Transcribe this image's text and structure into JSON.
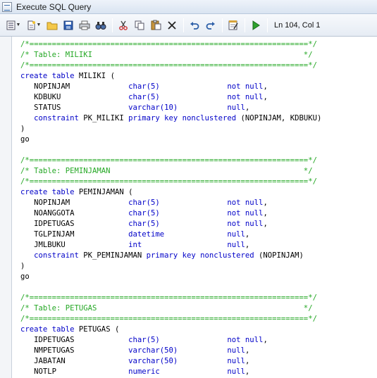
{
  "window": {
    "title": "Execute SQL Query"
  },
  "toolbar": {
    "buttons": [
      {
        "name": "properties-menu-button",
        "icon": "list-icon"
      },
      {
        "name": "new-menu-button",
        "icon": "new-file-icon"
      },
      {
        "name": "open-button",
        "icon": "folder-icon"
      },
      {
        "name": "save-button",
        "icon": "floppy-icon"
      },
      {
        "name": "print-button",
        "icon": "printer-icon"
      },
      {
        "name": "find-button",
        "icon": "binoculars-icon"
      },
      {
        "name": "cut-button",
        "icon": "scissors-icon"
      },
      {
        "name": "copy-button",
        "icon": "copy-icon"
      },
      {
        "name": "paste-button",
        "icon": "clipboard-icon"
      },
      {
        "name": "delete-button",
        "icon": "x-icon"
      },
      {
        "name": "undo-button",
        "icon": "undo-icon"
      },
      {
        "name": "redo-button",
        "icon": "redo-icon"
      },
      {
        "name": "edit-button",
        "icon": "notepad-icon"
      },
      {
        "name": "run-button",
        "icon": "play-icon"
      }
    ],
    "status": "Ln 104, Col 1"
  },
  "editor": {
    "lines": [
      [
        {
          "t": "/*==============================================================*/",
          "c": "cm"
        }
      ],
      [
        {
          "t": "/* Table: MILIKI                                               */",
          "c": "cm"
        }
      ],
      [
        {
          "t": "/*==============================================================*/",
          "c": "cm"
        }
      ],
      [
        {
          "t": "create table ",
          "c": "kw"
        },
        {
          "t": "MILIKI (",
          "c": "id"
        }
      ],
      [
        {
          "t": "   NOPINJAM             ",
          "c": "id"
        },
        {
          "t": "char(5)",
          "c": "kw"
        },
        {
          "t": "               ",
          "c": "id"
        },
        {
          "t": "not null",
          "c": "kw"
        },
        {
          "t": ",",
          "c": "id"
        }
      ],
      [
        {
          "t": "   KDBUKU               ",
          "c": "id"
        },
        {
          "t": "char(5)",
          "c": "kw"
        },
        {
          "t": "               ",
          "c": "id"
        },
        {
          "t": "not null",
          "c": "kw"
        },
        {
          "t": ",",
          "c": "id"
        }
      ],
      [
        {
          "t": "   STATUS               ",
          "c": "id"
        },
        {
          "t": "varchar(10)",
          "c": "kw"
        },
        {
          "t": "           ",
          "c": "id"
        },
        {
          "t": "null",
          "c": "kw"
        },
        {
          "t": ",",
          "c": "id"
        }
      ],
      [
        {
          "t": "   constraint ",
          "c": "kw"
        },
        {
          "t": "PK_MILIKI ",
          "c": "id"
        },
        {
          "t": "primary key nonclustered",
          "c": "kw"
        },
        {
          "t": " (NOPINJAM, KDBUKU)",
          "c": "id"
        }
      ],
      [
        {
          "t": ")",
          "c": "id"
        }
      ],
      [
        {
          "t": "go",
          "c": "id"
        }
      ],
      [
        {
          "t": "",
          "c": "id"
        }
      ],
      [
        {
          "t": "/*==============================================================*/",
          "c": "cm"
        }
      ],
      [
        {
          "t": "/* Table: PEMINJAMAN                                           */",
          "c": "cm"
        }
      ],
      [
        {
          "t": "/*==============================================================*/",
          "c": "cm"
        }
      ],
      [
        {
          "t": "create table ",
          "c": "kw"
        },
        {
          "t": "PEMINJAMAN (",
          "c": "id"
        }
      ],
      [
        {
          "t": "   NOPINJAM             ",
          "c": "id"
        },
        {
          "t": "char(5)",
          "c": "kw"
        },
        {
          "t": "               ",
          "c": "id"
        },
        {
          "t": "not null",
          "c": "kw"
        },
        {
          "t": ",",
          "c": "id"
        }
      ],
      [
        {
          "t": "   NOANGGOTA            ",
          "c": "id"
        },
        {
          "t": "char(5)",
          "c": "kw"
        },
        {
          "t": "               ",
          "c": "id"
        },
        {
          "t": "not null",
          "c": "kw"
        },
        {
          "t": ",",
          "c": "id"
        }
      ],
      [
        {
          "t": "   IDPETUGAS            ",
          "c": "id"
        },
        {
          "t": "char(5)",
          "c": "kw"
        },
        {
          "t": "               ",
          "c": "id"
        },
        {
          "t": "not null",
          "c": "kw"
        },
        {
          "t": ",",
          "c": "id"
        }
      ],
      [
        {
          "t": "   TGLPINJAM            ",
          "c": "id"
        },
        {
          "t": "datetime",
          "c": "kw"
        },
        {
          "t": "              ",
          "c": "id"
        },
        {
          "t": "null",
          "c": "kw"
        },
        {
          "t": ",",
          "c": "id"
        }
      ],
      [
        {
          "t": "   JMLBUKU              ",
          "c": "id"
        },
        {
          "t": "int",
          "c": "kw"
        },
        {
          "t": "                   ",
          "c": "id"
        },
        {
          "t": "null",
          "c": "kw"
        },
        {
          "t": ",",
          "c": "id"
        }
      ],
      [
        {
          "t": "   constraint ",
          "c": "kw"
        },
        {
          "t": "PK_PEMINJAMAN ",
          "c": "id"
        },
        {
          "t": "primary key nonclustered",
          "c": "kw"
        },
        {
          "t": " (NOPINJAM)",
          "c": "id"
        }
      ],
      [
        {
          "t": ")",
          "c": "id"
        }
      ],
      [
        {
          "t": "go",
          "c": "id"
        }
      ],
      [
        {
          "t": "",
          "c": "id"
        }
      ],
      [
        {
          "t": "/*==============================================================*/",
          "c": "cm"
        }
      ],
      [
        {
          "t": "/* Table: PETUGAS                                              */",
          "c": "cm"
        }
      ],
      [
        {
          "t": "/*==============================================================*/",
          "c": "cm"
        }
      ],
      [
        {
          "t": "create table ",
          "c": "kw"
        },
        {
          "t": "PETUGAS (",
          "c": "id"
        }
      ],
      [
        {
          "t": "   IDPETUGAS            ",
          "c": "id"
        },
        {
          "t": "char(5)",
          "c": "kw"
        },
        {
          "t": "               ",
          "c": "id"
        },
        {
          "t": "not null",
          "c": "kw"
        },
        {
          "t": ",",
          "c": "id"
        }
      ],
      [
        {
          "t": "   NMPETUGAS            ",
          "c": "id"
        },
        {
          "t": "varchar(50)",
          "c": "kw"
        },
        {
          "t": "           ",
          "c": "id"
        },
        {
          "t": "null",
          "c": "kw"
        },
        {
          "t": ",",
          "c": "id"
        }
      ],
      [
        {
          "t": "   JABATAN              ",
          "c": "id"
        },
        {
          "t": "varchar(50)",
          "c": "kw"
        },
        {
          "t": "           ",
          "c": "id"
        },
        {
          "t": "null",
          "c": "kw"
        },
        {
          "t": ",",
          "c": "id"
        }
      ],
      [
        {
          "t": "   NOTLP                ",
          "c": "id"
        },
        {
          "t": "numeric",
          "c": "kw"
        },
        {
          "t": "               ",
          "c": "id"
        },
        {
          "t": "null",
          "c": "kw"
        },
        {
          "t": ",",
          "c": "id"
        }
      ]
    ]
  }
}
